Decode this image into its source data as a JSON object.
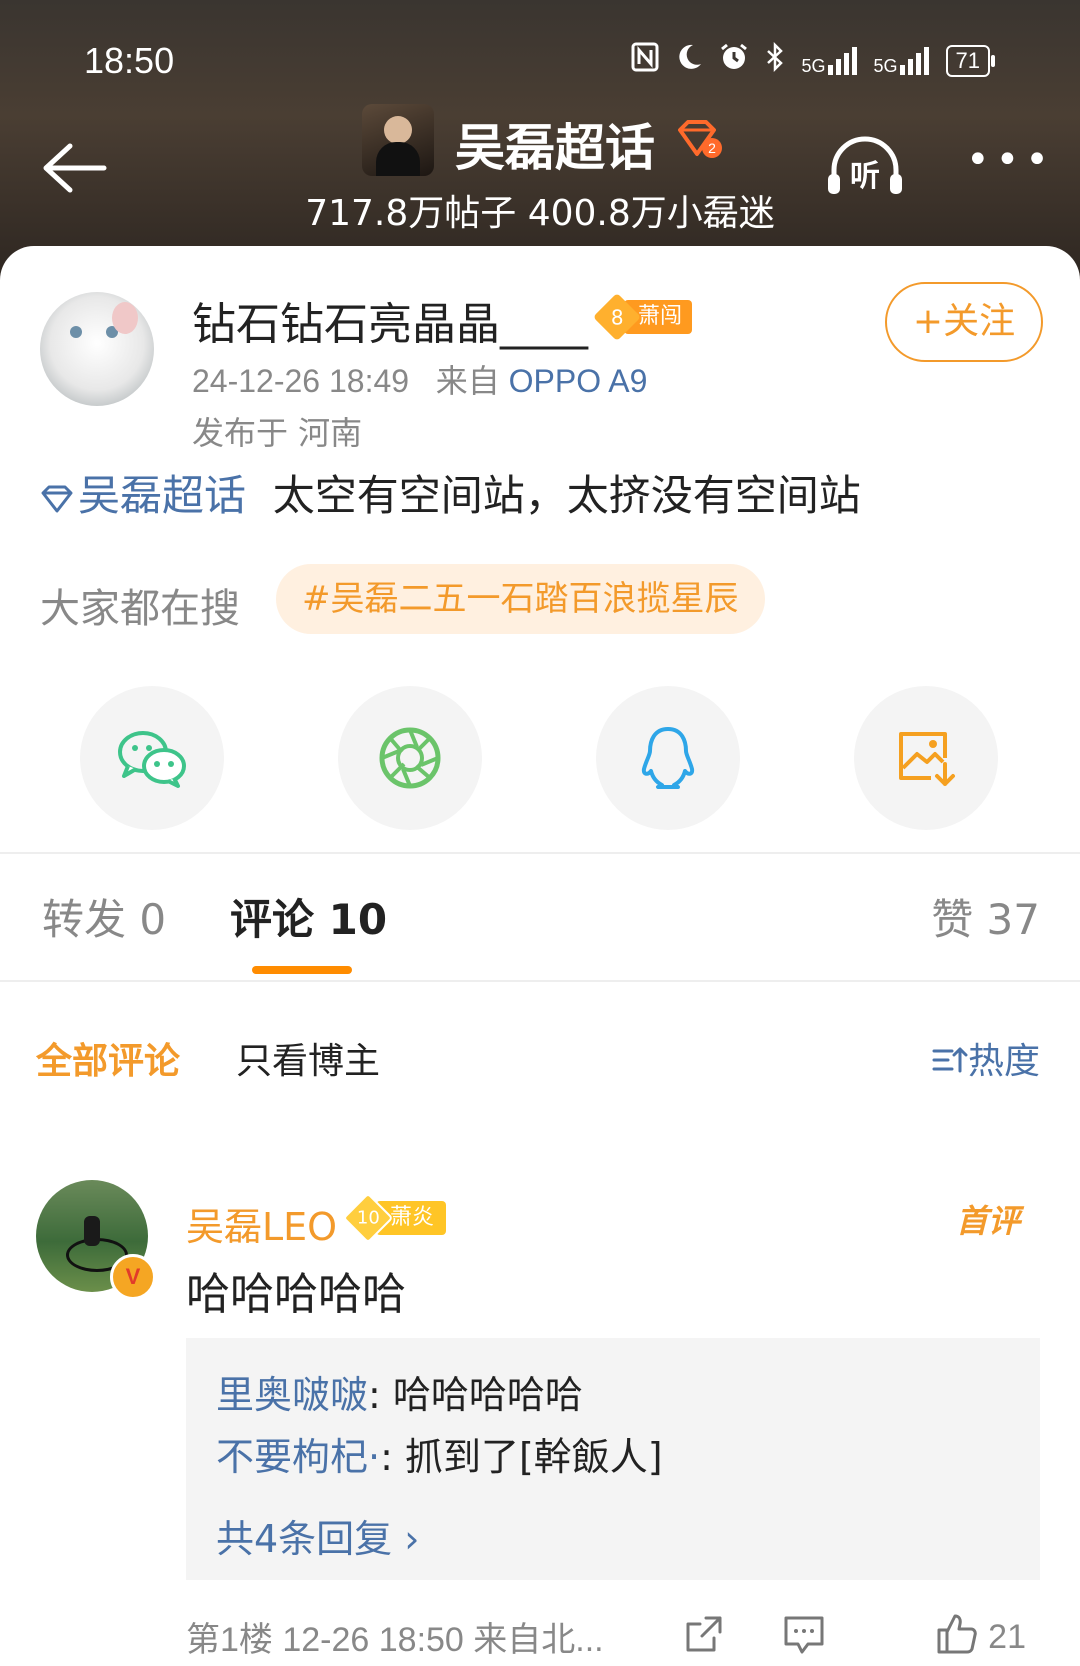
{
  "status_bar": {
    "time": "18:50",
    "network1": "5G",
    "network2": "5G",
    "battery": "71"
  },
  "header": {
    "topic_title": "吴磊超话",
    "topic_level": "2",
    "stats": "717.8万帖子 400.8万小磊迷",
    "listen_label": "听",
    "more_label": "•••"
  },
  "post": {
    "username": "钻石钻石亮晶晶____",
    "level": "8",
    "level_name": "萧闯",
    "follow_label": "+关注",
    "timestamp": "24-12-26 18:49",
    "from_label": "来自",
    "device": "OPPO A9",
    "location": "发布于 河南",
    "topic_link": "吴磊超话",
    "content": "太空有空间站，太挤没有空间站",
    "search_label": "大家都在搜",
    "search_chip": "#吴磊二五一石踏百浪揽星辰"
  },
  "share": {
    "items": [
      "wechat-icon",
      "moments-icon",
      "qq-icon",
      "save-image-icon"
    ]
  },
  "tabs": {
    "repost": "转发 0",
    "comments": "评论 10",
    "likes": "赞 37"
  },
  "filter": {
    "all": "全部评论",
    "owner_only": "只看博主",
    "sort": "热度"
  },
  "comment": {
    "name": "吴磊LEO",
    "level": "10",
    "level_name": "萧炎",
    "first_tag": "首评",
    "text": "哈哈哈哈哈",
    "replies": [
      {
        "name": "里奥啵啵",
        "text": ": 哈哈哈哈哈"
      },
      {
        "name": "不要枸杞·",
        "text": ": 抓到了[幹飯人]"
      }
    ],
    "more_replies": "共4条回复 ›",
    "floor_info": "第1楼  12-26 18:50  来自北...",
    "like_count": "21"
  },
  "colors": {
    "accent_orange": "#f39a2b",
    "link_blue": "#4a72a8",
    "wechat_green": "#3ec48a",
    "qq_blue": "#2ea6e8"
  }
}
